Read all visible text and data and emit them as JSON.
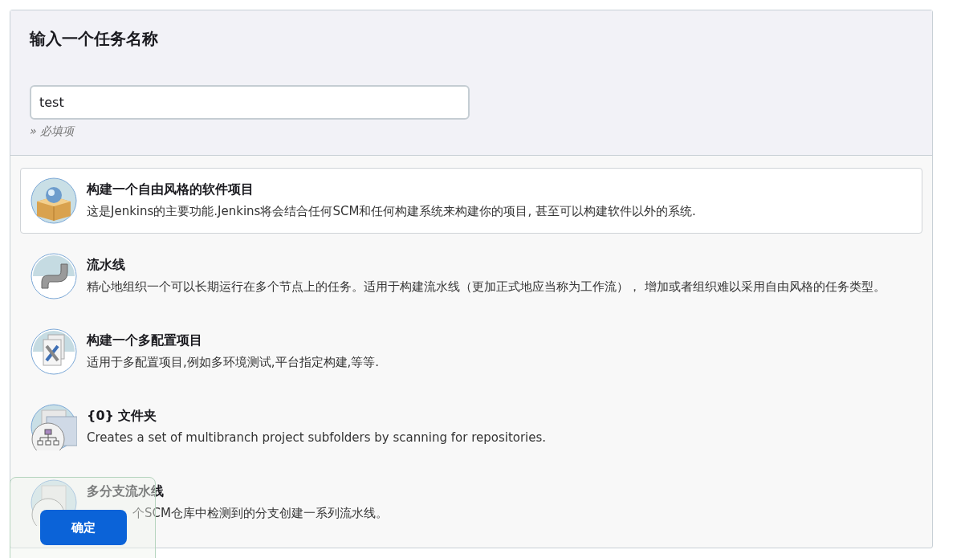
{
  "title": "输入一个任务名称",
  "name_field": {
    "value": "test"
  },
  "hint": "» 必填项",
  "items": [
    {
      "kind": "freestyle",
      "title": "构建一个自由风格的软件项目",
      "description": "这是Jenkins的主要功能.Jenkins将会结合任何SCM和任何构建系统来构建你的项目, 甚至可以构建软件以外的系统.",
      "selected": true,
      "covered": false
    },
    {
      "kind": "pipeline",
      "title": "流水线",
      "description": "精心地组织一个可以长期运行在多个节点上的任务。适用于构建流水线（更加正式地应当称为工作流）， 增加或者组织难以采用自由风格的任务类型。",
      "selected": false,
      "covered": false
    },
    {
      "kind": "matrix",
      "title": "构建一个多配置项目",
      "description": "适用于多配置项目,例如多环境测试,平台指定构建,等等.",
      "selected": false,
      "covered": false
    },
    {
      "kind": "folder",
      "title": "{0} 文件夹",
      "description": "Creates a set of multibranch project subfolders by scanning for repositories.",
      "selected": false,
      "covered": false
    },
    {
      "kind": "multibranch",
      "title": "多分支流水线",
      "description": "个SCM仓库中检测到的分支创建一系列流水线。",
      "selected": false,
      "covered": true
    }
  ],
  "footer": {
    "button": "确定"
  }
}
